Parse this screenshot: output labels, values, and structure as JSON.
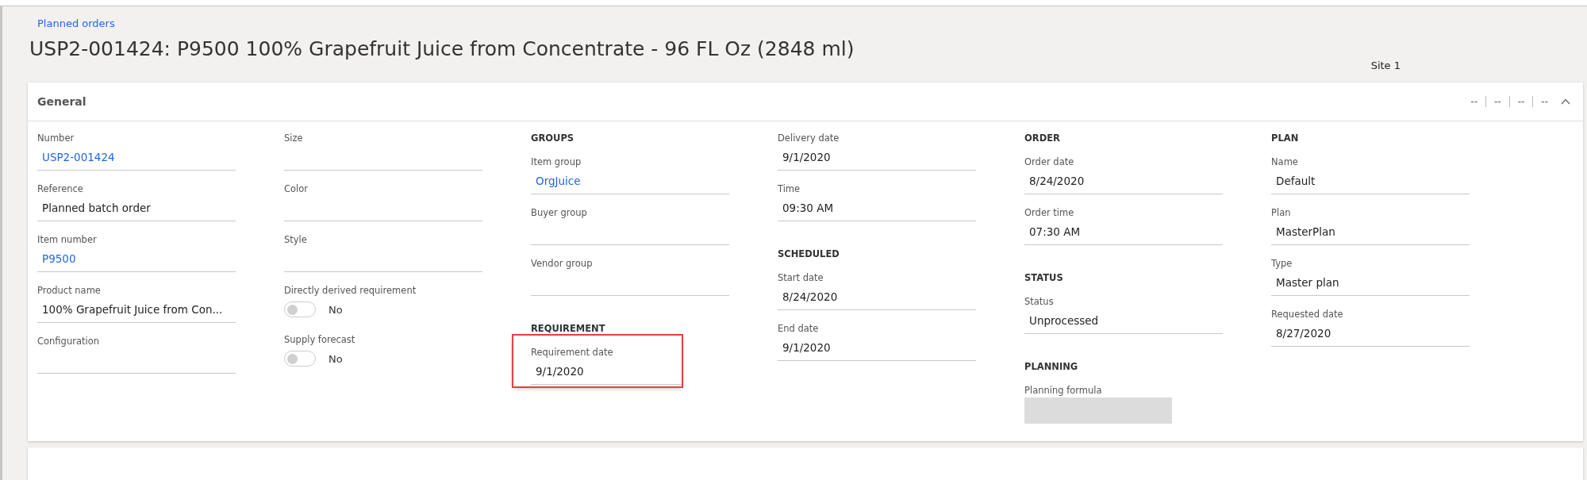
{
  "breadcrumb": "Planned orders",
  "title": "USP2-001424: P9500 100% Grapefruit Juice from Concentrate - 96 FL Oz (2848 ml)",
  "site": "Site 1",
  "section": {
    "title": "General",
    "expanded": true,
    "summary": [
      "--",
      "--",
      "--",
      "--"
    ],
    "columns": [
      [
        {
          "kind": "field",
          "label": "Number",
          "value": "USP2-001424",
          "link": true
        },
        {
          "kind": "field",
          "label": "Reference",
          "value": "Planned batch order",
          "link": false
        },
        {
          "kind": "field",
          "label": "Item number",
          "value": "P9500",
          "link": true
        },
        {
          "kind": "field",
          "label": "Product name",
          "value": "100% Grapefruit Juice from Con...",
          "link": false
        },
        {
          "kind": "field",
          "label": "Configuration",
          "link": false
        }
      ],
      [
        {
          "kind": "field",
          "label": "Size",
          "link": false
        },
        {
          "kind": "field",
          "label": "Color",
          "link": false
        },
        {
          "kind": "field",
          "label": "Style",
          "link": false
        },
        {
          "kind": "toggle",
          "label": "Directly derived requirement",
          "on": false,
          "value": "No"
        },
        {
          "kind": "toggle",
          "label": "Supply forecast",
          "on": false,
          "value": "No"
        }
      ],
      [
        {
          "kind": "heading",
          "label": "GROUPS"
        },
        {
          "kind": "field",
          "label": "Item group",
          "value": "OrgJuice",
          "link": true
        },
        {
          "kind": "field",
          "label": "Buyer group",
          "link": false
        },
        {
          "kind": "field",
          "label": "Vendor group",
          "link": false
        },
        {
          "kind": "heading",
          "label": "REQUIREMENT"
        },
        {
          "kind": "field",
          "label": "Requirement date",
          "value": "9/1/2020",
          "link": false,
          "highlighted": true
        }
      ],
      [
        {
          "kind": "field",
          "label": "Delivery date",
          "value": "9/1/2020",
          "link": false
        },
        {
          "kind": "field",
          "label": "Time",
          "value": "09:30 AM",
          "link": false
        },
        {
          "kind": "heading",
          "label": "SCHEDULED"
        },
        {
          "kind": "field",
          "label": "Start date",
          "value": "8/24/2020",
          "link": false
        },
        {
          "kind": "field",
          "label": "End date",
          "value": "9/1/2020",
          "link": false
        }
      ],
      [
        {
          "kind": "heading",
          "label": "ORDER"
        },
        {
          "kind": "field",
          "label": "Order date",
          "value": "8/24/2020",
          "link": false
        },
        {
          "kind": "field",
          "label": "Order time",
          "value": "07:30 AM",
          "link": false
        },
        {
          "kind": "heading",
          "label": "STATUS"
        },
        {
          "kind": "field",
          "label": "Status",
          "value": "Unprocessed",
          "link": false
        },
        {
          "kind": "heading",
          "label": "PLANNING"
        },
        {
          "kind": "disabled",
          "label": "Planning formula"
        }
      ],
      [
        {
          "kind": "heading",
          "label": "PLAN"
        },
        {
          "kind": "field",
          "label": "Name",
          "value": "Default",
          "link": false
        },
        {
          "kind": "field",
          "label": "Plan",
          "value": "MasterPlan",
          "link": false
        },
        {
          "kind": "field",
          "label": "Type",
          "value": "Master plan",
          "link": false
        },
        {
          "kind": "field",
          "label": "Requested date",
          "value": "8/27/2020",
          "link": false
        }
      ]
    ]
  }
}
